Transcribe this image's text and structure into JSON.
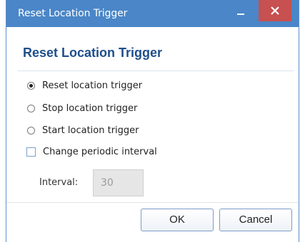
{
  "window": {
    "title": "Reset Location Trigger",
    "titlebar_color": "#4a86c8",
    "close_color": "#c75050"
  },
  "dialog": {
    "heading": "Reset Location Trigger",
    "heading_color": "#1e4e8c",
    "options": [
      {
        "label": "Reset location trigger",
        "selected": true
      },
      {
        "label": "Stop location trigger",
        "selected": false
      },
      {
        "label": "Start location trigger",
        "selected": false
      }
    ],
    "change_interval": {
      "label": "Change periodic interval",
      "checked": false
    },
    "interval": {
      "label": "Interval:",
      "value": "30",
      "disabled": true
    }
  },
  "buttons": {
    "ok": "OK",
    "cancel": "Cancel"
  }
}
